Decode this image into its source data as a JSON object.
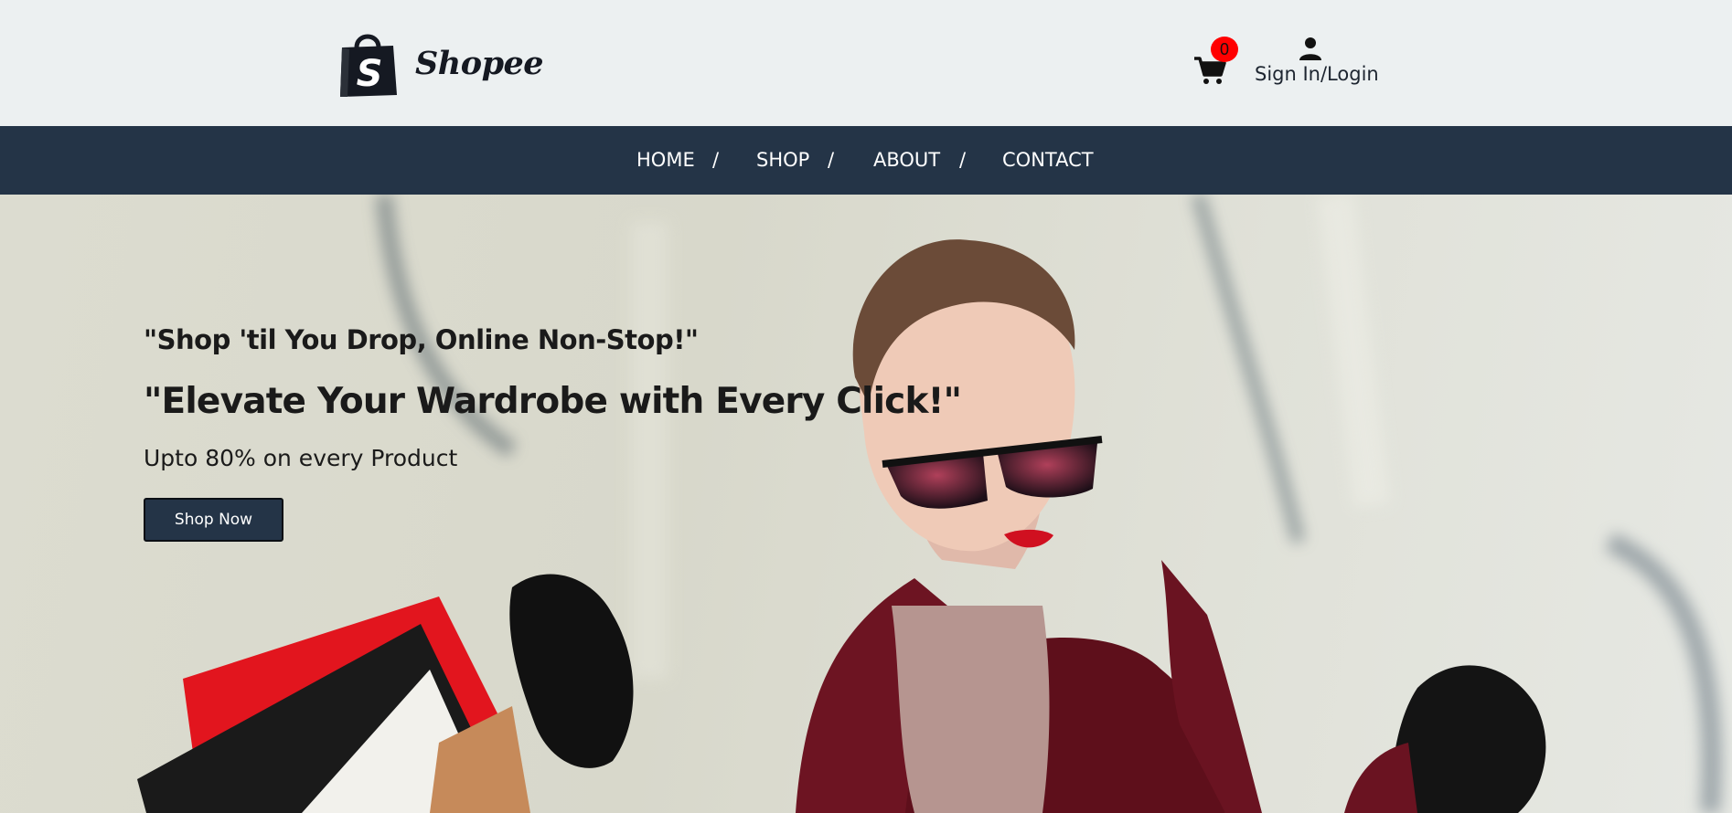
{
  "brand": {
    "name": "Shopee",
    "logo_letter": "S"
  },
  "header": {
    "cart_count": "0",
    "login_label": "Sign In/Login"
  },
  "nav": {
    "items": [
      "HOME",
      "SHOP",
      "ABOUT",
      "CONTACT"
    ],
    "separator": "/"
  },
  "hero": {
    "tagline1": "\"Shop 'til You Drop, Online Non-Stop!\"",
    "tagline2": "\"Elevate Your Wardrobe with Every Click!\"",
    "offer": "Upto 80% on every Product",
    "cta_label": "Shop Now"
  },
  "colors": {
    "header_bg": "#ecf0f1",
    "nav_bg": "#243447",
    "button_bg": "#243447",
    "badge": "#ff0000",
    "text": "#1a1a1a"
  },
  "icons": [
    "shopping-bag-logo-icon",
    "cart-icon",
    "user-icon"
  ]
}
